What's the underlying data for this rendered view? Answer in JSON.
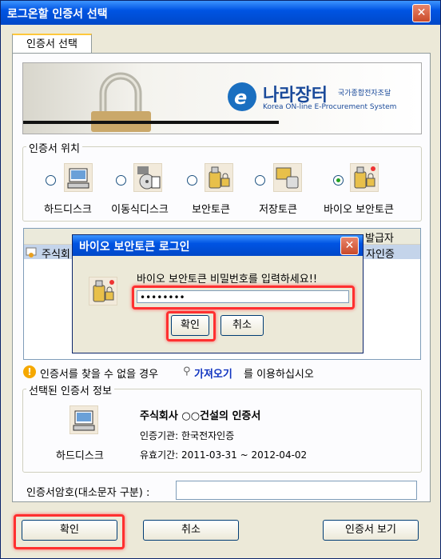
{
  "window": {
    "title": "로그온할 인증서 선택"
  },
  "tab": {
    "label": "인증서 선택"
  },
  "banner": {
    "logo_main": "나라장터",
    "logo_sub": "국가종합전자조달",
    "logo_en": "Korea ON-line E-Procurement System"
  },
  "location": {
    "title": "인증서 위치",
    "items": [
      {
        "label": "하드디스크",
        "selected": false
      },
      {
        "label": "이동식디스크",
        "selected": false
      },
      {
        "label": "보안토큰",
        "selected": false
      },
      {
        "label": "저장토큰",
        "selected": false
      },
      {
        "label": "바이오 보안토큰",
        "selected": true
      }
    ]
  },
  "list": {
    "headers": [
      "발급자"
    ],
    "row_name": "주식회",
    "row_issuer": "자인증"
  },
  "dialog": {
    "title": "바이오 보안토큰 로그인",
    "prompt": "바이오 보안토큰 비밀번호를 입력하세요!!",
    "password": "••••••••",
    "ok": "확인",
    "cancel": "취소"
  },
  "notice": {
    "before": "인증서를 찾을 수 없을 경우",
    "link": "가져오기",
    "after": "를 이용하십시오"
  },
  "selected": {
    "title": "선택된 인증서 정보",
    "icon_label": "하드디스크",
    "name": "주식회사 ○○건설의 인증서",
    "issuer": "인증기관: 한국전자인증",
    "validity": "유효기간: 2011-03-31 ~ 2012-04-02"
  },
  "password_field": {
    "label": "인증서암호(대소문자 구분) :"
  },
  "buttons": {
    "ok": "확인",
    "cancel": "취소",
    "view": "인증서 보기"
  }
}
